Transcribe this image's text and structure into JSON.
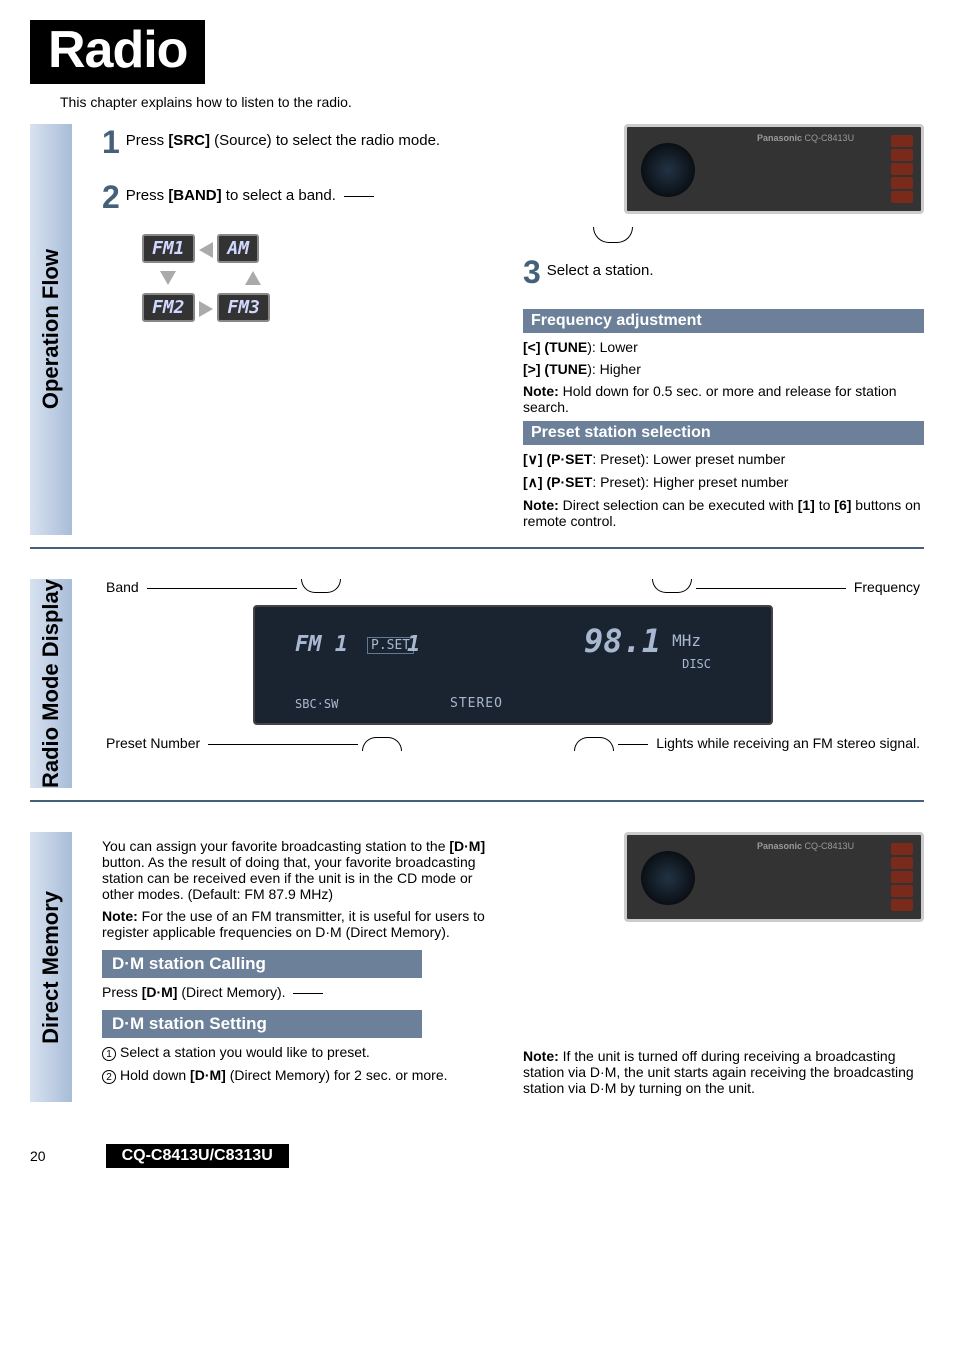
{
  "page": {
    "title": "Radio",
    "intro": "This chapter explains how to listen to the radio.",
    "page_number": "20",
    "model": "CQ-C8413U/C8313U"
  },
  "sections": {
    "operation_flow": {
      "label": "Operation Flow",
      "step1_text_a": "Press ",
      "step1_text_b": "[SRC]",
      "step1_text_c": " (Source) to select the radio mode.",
      "step2_text_a": "Press ",
      "step2_text_b": "[BAND]",
      "step2_text_c": " to select a band.",
      "step3_text": "Select a station.",
      "bands": [
        "FM1",
        "AM",
        "FM2",
        "FM3"
      ],
      "freq_header": "Frequency adjustment",
      "freq_lower_a": "[<] (",
      "freq_lower_b": "TUNE",
      "freq_lower_c": "): Lower",
      "freq_higher_a": "[>] (",
      "freq_higher_b": "TUNE",
      "freq_higher_c": "): Higher",
      "freq_note_label": "Note:",
      "freq_note": " Hold down for 0.5 sec. or more and release for station search.",
      "preset_header": "Preset station selection",
      "preset_lower_a": "[∨] (",
      "preset_lower_b": "P·SET",
      "preset_lower_c": ": Preset): Lower preset number",
      "preset_higher_a": "[∧] (",
      "preset_higher_b": "P·SET",
      "preset_higher_c": ": Preset): Higher preset number",
      "preset_note_label": "Note:",
      "preset_note_a": " Direct selection can be executed with ",
      "preset_note_b": "[1]",
      "preset_note_c": " to ",
      "preset_note_d": "[6]",
      "preset_note_e": " buttons on remote control.",
      "device_brand": "Panasonic",
      "device_model": "CQ-C8413U"
    },
    "radio_mode_display": {
      "label": "Radio Mode Display",
      "label_band": "Band",
      "label_frequency": "Frequency",
      "label_preset_number": "Preset Number",
      "label_stereo": "Lights while receiving an FM stereo signal.",
      "lcd": {
        "band": "FM 1",
        "pset": "P.SET",
        "pnum": "1",
        "freq": "98.1",
        "unit": "MHz",
        "disc": "DISC",
        "stereo": "STEREO",
        "sbc": "SBC·SW"
      }
    },
    "direct_memory": {
      "label": "Direct Memory",
      "para_a": "You can assign your favorite broadcasting station to the ",
      "para_b": "[D·M]",
      "para_c": " button. As the result of doing that, your favorite broadcasting station can be received even if the unit is in the CD mode or other modes. (Default: FM 87.9 MHz)",
      "para_note_label": "Note:",
      "para_note": " For the use of an FM transmitter, it is useful for users to register applicable frequencies on D·M (Direct Memory).",
      "calling_header": "D·M station Calling",
      "calling_text_a": "Press ",
      "calling_text_b": "[D·M]",
      "calling_text_c": " (Direct Memory).",
      "setting_header": "D·M station Setting",
      "setting_step1": "Select a station you would like to preset.",
      "setting_step2_a": "Hold down ",
      "setting_step2_b": "[D·M]",
      "setting_step2_c": " (Direct Memory) for 2 sec. or more.",
      "right_note_label": "Note:",
      "right_note": " If the unit is turned off during receiving a broadcasting station via D·M, the unit starts again receiving the broadcasting station via D·M by turning on the unit.",
      "device_brand": "Panasonic",
      "device_model": "CQ-C8413U"
    }
  }
}
